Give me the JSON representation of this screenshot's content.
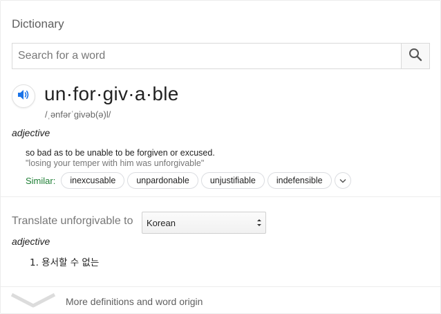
{
  "widget": {
    "title": "Dictionary"
  },
  "search": {
    "placeholder": "Search for a word",
    "value": ""
  },
  "entry": {
    "headword": "un·for·giv·a·ble",
    "phonetic": "/ˌənfərˈɡivəb(ə)l/",
    "part_of_speech": "adjective",
    "definition": "so bad as to be unable to be forgiven or excused.",
    "example": "\"losing your temper with him was unforgivable\"",
    "similar_label": "Similar:",
    "similar": [
      "inexcusable",
      "unpardonable",
      "unjustifiable",
      "indefensible"
    ]
  },
  "translate": {
    "label": "Translate unforgivable to",
    "selected_language": "Korean",
    "part_of_speech": "adjective",
    "translations": [
      "1. 용서할 수 없는"
    ]
  },
  "footer": {
    "more_label": "More definitions and word origin"
  },
  "icons": {
    "search": "search-icon",
    "speaker": "speaker-icon",
    "expand": "chevron-down-icon",
    "more": "chevron-down-icon"
  },
  "colors": {
    "similar_label": "#1e7e34",
    "speaker": "#1a73e8"
  }
}
